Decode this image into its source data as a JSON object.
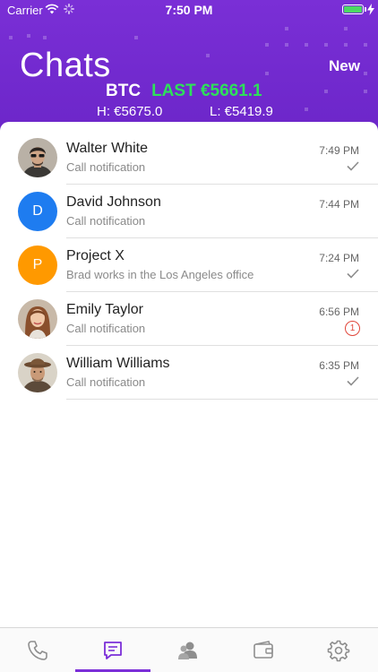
{
  "status_bar": {
    "carrier": "Carrier",
    "time": "7:50 PM",
    "battery_color": "#4cd964"
  },
  "header": {
    "title": "Chats",
    "new_label": "New",
    "ticker": {
      "symbol": "BTC",
      "last": "LAST €5661.1",
      "high": "H: €5675.0",
      "low": "L: €5419.9"
    },
    "gradient_color": "#7a2fd6",
    "ticker_color": "#2ee05a"
  },
  "chats": [
    {
      "name": "Walter White",
      "subtitle": "Call notification",
      "time": "7:49 PM",
      "status": "read",
      "avatar": "photo"
    },
    {
      "name": "David Johnson",
      "subtitle": "Call notification",
      "time": "7:44 PM",
      "status": "none",
      "avatar": "letter",
      "letter": "D",
      "avatar_color": "#1e7cf0"
    },
    {
      "name": "Project X",
      "subtitle": "Brad works in the Los Angeles office",
      "time": "7:24 PM",
      "status": "read",
      "avatar": "letter",
      "letter": "P",
      "avatar_color": "#ff9900"
    },
    {
      "name": "Emily Taylor",
      "subtitle": "Call notification",
      "time": "6:56 PM",
      "status": "unread",
      "unread_count": "1",
      "avatar": "photo"
    },
    {
      "name": "William Williams",
      "subtitle": "Call notification",
      "time": "6:35 PM",
      "status": "read",
      "avatar": "photo"
    }
  ],
  "tabbar": {
    "tabs": [
      "phone-icon",
      "chat-bubble-icon",
      "contacts-icon",
      "wallet-icon",
      "gear-icon"
    ],
    "active_index": 1,
    "active_color": "#7b2fd8",
    "inactive_color": "#8e8e8e"
  }
}
